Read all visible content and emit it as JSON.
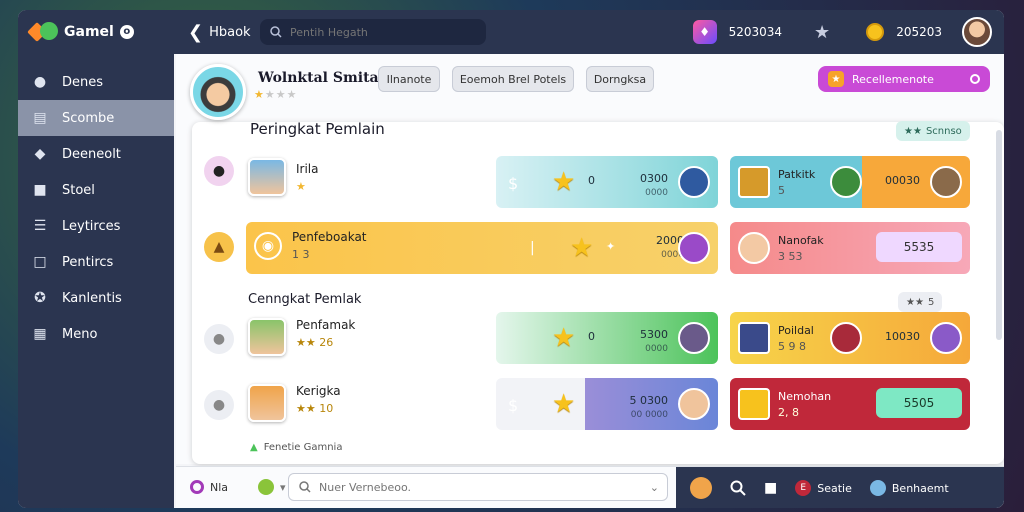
{
  "app": {
    "logo_text": "Gamel",
    "logo_badge": "o",
    "back_label": "Hbaok",
    "search_placeholder": "Pentih Hegath",
    "gem_count": "5203034",
    "coin_count": "205203"
  },
  "sidebar": {
    "items": [
      {
        "label": "Denes",
        "icon": "user-icon"
      },
      {
        "label": "Scombe",
        "icon": "card-icon"
      },
      {
        "label": "Deeneolt",
        "icon": "shield-icon"
      },
      {
        "label": "Stoel",
        "icon": "lock-icon"
      },
      {
        "label": "Leytirces",
        "icon": "list-icon"
      },
      {
        "label": "Pentircs",
        "icon": "chart-icon"
      },
      {
        "label": "Kanlentis",
        "icon": "puzzle-icon"
      },
      {
        "label": "Meno",
        "icon": "grid-icon"
      }
    ]
  },
  "profile": {
    "name": "Wolnktal Smitaf",
    "chips": [
      "Ilnanote",
      "Eoemoh Brel Potels",
      "Dorngksa"
    ],
    "recommend_label": "Recellemenote"
  },
  "panel": {
    "title": "Peringkat Pemlain",
    "badge1": "Scnnso",
    "section2_title": "Cenngkat Pemlak",
    "badge2": "5"
  },
  "rows": [
    {
      "name": "Irila",
      "stars": "★",
      "card_value": "0300",
      "card_sub": "0000",
      "card_mark": "0",
      "right_name": "Patkitk",
      "right_sub": "5",
      "right_value": "00030"
    },
    {
      "name": "Penfeboakat",
      "sub": "1 3",
      "card_value": "2000",
      "card_sub": "0000",
      "right_name": "Nanofak",
      "right_sub": "3 53",
      "button": "5535"
    },
    {
      "name": "Penfamak",
      "stars": "★★ 26",
      "card_value": "5300",
      "card_sub": "0000",
      "card_mark": "0",
      "right_name": "Poildal",
      "right_sub": "5 9 8",
      "right_value": "10030"
    },
    {
      "name": "Kerigka",
      "stars": "★★ 10",
      "card_value": "5 0300",
      "card_sub": "00 0000",
      "right_name": "Nemohan",
      "right_sub": "2, 8",
      "button": "5505"
    }
  ],
  "footer_note": "Fenetie Gamnia",
  "bottombar": {
    "left_label": "Nla",
    "search_placeholder": "Nuer Vernebeoo.",
    "label_1": "Seatie",
    "label_2": "Benhaemt"
  },
  "colors": {
    "nav": "#2b3550",
    "accent": "#c94ad6"
  }
}
